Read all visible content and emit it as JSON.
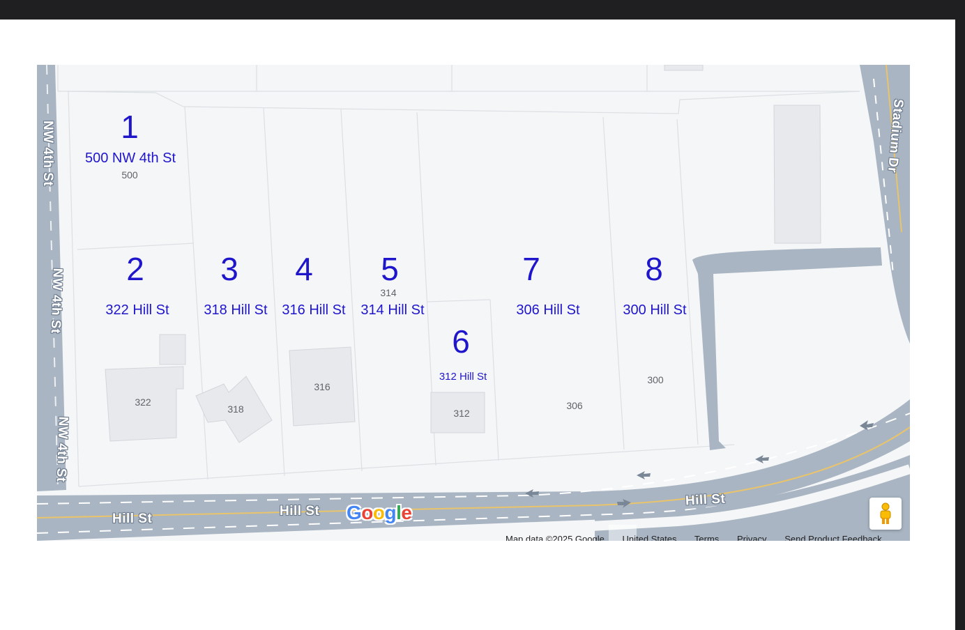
{
  "map": {
    "lots": [
      {
        "number": "1",
        "address": "500 NW 4th St",
        "parcel": "500"
      },
      {
        "number": "2",
        "address": "322 Hill St",
        "parcel": "322"
      },
      {
        "number": "3",
        "address": "318 Hill St",
        "parcel": "318"
      },
      {
        "number": "4",
        "address": "316 Hill St",
        "parcel": "316"
      },
      {
        "number": "5",
        "address": "314 Hill St",
        "parcel": "314"
      },
      {
        "number": "6",
        "address": "312 Hill St",
        "parcel": "312"
      },
      {
        "number": "7",
        "address": "306 Hill St",
        "parcel": "306"
      },
      {
        "number": "8",
        "address": "300 Hill St",
        "parcel": "300"
      }
    ],
    "roads": {
      "nw4th": "NW 4th St",
      "hill": "Hill St",
      "stadium": "Stadium Dr"
    },
    "logo": {
      "g1": "G",
      "o1": "o",
      "o2": "o",
      "g2": "g",
      "l": "l",
      "e": "e"
    },
    "footer": {
      "map_data": "Map data ©2025 Google",
      "region": "United States",
      "terms": "Terms",
      "privacy": "Privacy",
      "feedback": "Send Product Feedback"
    },
    "colors": {
      "label": "#1f16cc",
      "road": "#a9b5c3",
      "lot_bg": "#f5f6f7",
      "building": "#e7e9ec"
    },
    "icons": {
      "street_view": "pegman-icon"
    }
  }
}
